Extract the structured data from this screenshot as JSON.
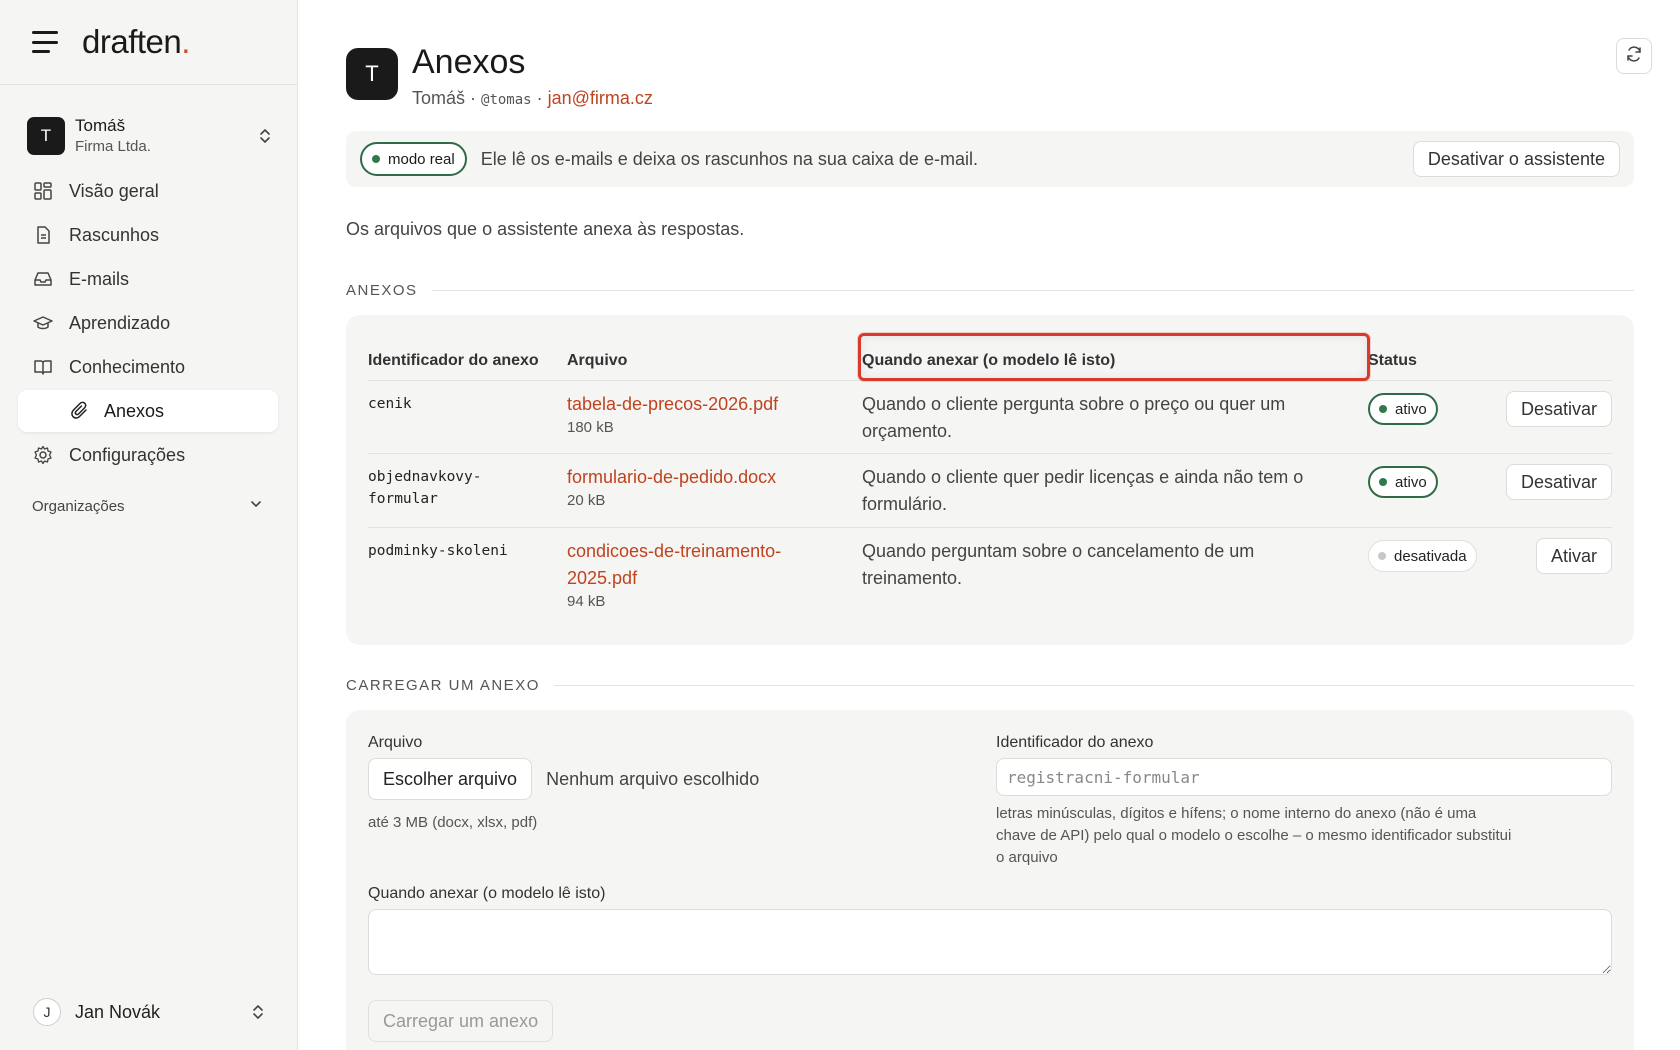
{
  "brand": {
    "logo_text": "draften",
    "logo_dot": "."
  },
  "account": {
    "initial": "T",
    "name": "Tomáš",
    "org": "Firma Ltda."
  },
  "nav": {
    "overview": "Visão geral",
    "drafts": "Rascunhos",
    "emails": "E-mails",
    "learning": "Aprendizado",
    "knowledge": "Conhecimento",
    "attachments": "Anexos",
    "settings": "Configurações",
    "organizations": "Organizações"
  },
  "user": {
    "initial": "J",
    "name": "Jan Novák"
  },
  "header": {
    "initial": "T",
    "title": "Anexos",
    "name": "Tomáš",
    "sep1": " · ",
    "handle": "@tomas",
    "sep2": " · ",
    "email": "jan@firma.cz"
  },
  "mode": {
    "pill": "modo real",
    "text": "Ele lê os e-mails e deixa os rascunhos na sua caixa de e-mail.",
    "disable_button": "Desativar o assistente"
  },
  "intro": "Os arquivos que o assistente anexa às respostas.",
  "attachments_section": {
    "heading": "ANEXOS",
    "columns": {
      "id": "Identificador do anexo",
      "file": "Arquivo",
      "when": "Quando anexar (o modelo lê isto)",
      "status": "Status"
    },
    "rows": [
      {
        "id": "cenik",
        "file": "tabela-de-precos-2026.pdf",
        "size": "180 kB",
        "when": "Quando o cliente pergunta sobre o preço ou quer um orçamento.",
        "status": "ativo",
        "action": "Desativar"
      },
      {
        "id": "objednavkovy-formular",
        "file": "formulario-de-pedido.docx",
        "size": "20 kB",
        "when": "Quando o cliente quer pedir licenças e ainda não tem o formulário.",
        "status": "ativo",
        "action": "Desativar"
      },
      {
        "id": "podminky-skoleni",
        "file": "condicoes-de-treinamento-2025.pdf",
        "size": "94 kB",
        "when": "Quando perguntam sobre o cancelamento de um treinamento.",
        "status": "desativada",
        "action": "Ativar"
      }
    ]
  },
  "upload_section": {
    "heading": "CARREGAR UM ANEXO",
    "file_label": "Arquivo",
    "choose_button": "Escolher arquivo",
    "no_file": "Nenhum arquivo escolhido",
    "file_hint": "até 3 MB (docx, xlsx, pdf)",
    "id_label": "Identificador do anexo",
    "id_placeholder": "registracni-formular",
    "id_help": "letras minúsculas, dígitos e hífens; o nome interno do anexo (não é uma chave de API) pelo qual o modelo o escolhe – o mesmo identificador substitui o arquivo",
    "when_label": "Quando anexar (o modelo lê isto)",
    "submit_button": "Carregar um anexo"
  },
  "colors": {
    "accent": "#c0431f",
    "active_green": "#2d7a4b",
    "highlight": "#d93a2b"
  }
}
